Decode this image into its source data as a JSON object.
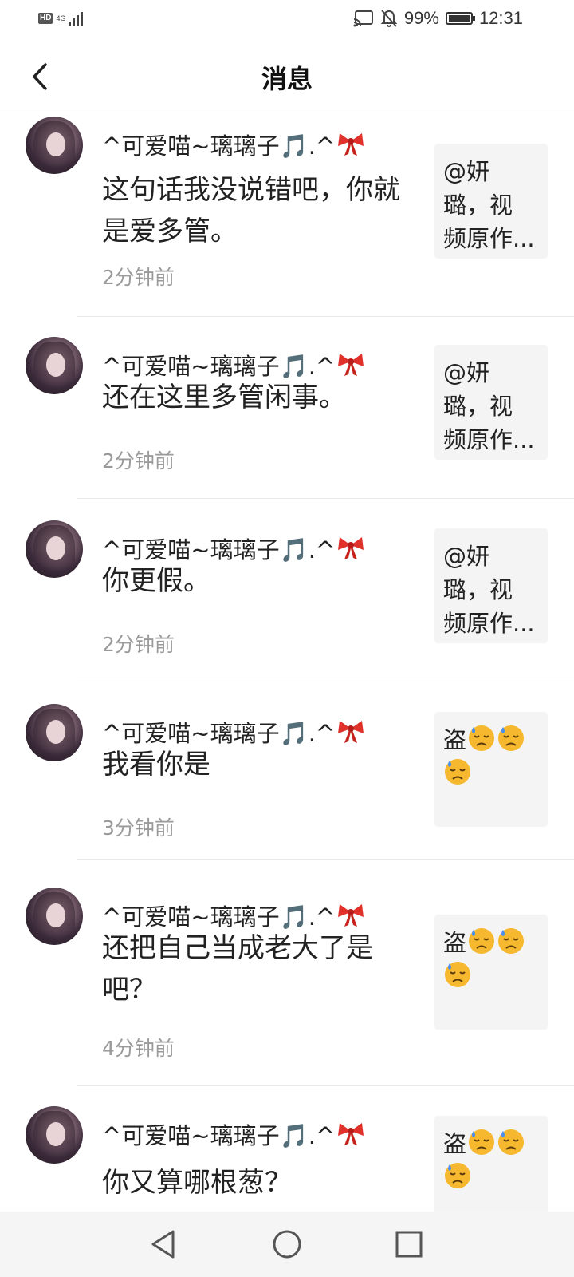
{
  "status_bar": {
    "hd": "HD",
    "network": "4G",
    "battery_percent": "99%",
    "time": "12:31"
  },
  "header": {
    "title": "消息"
  },
  "messages": [
    {
      "nickname": "^可爱喵~璃璃子🎵.^",
      "text": "这句话我没说错吧，你就是爱多管。",
      "time": "2分钟前",
      "preview_lines": [
        "@妍",
        "璐，视",
        "频原作..."
      ]
    },
    {
      "nickname": "^可爱喵~璃璃子🎵.^",
      "text": "还在这里多管闲事。",
      "time": "2分钟前",
      "preview_lines": [
        "@妍",
        "璐，视",
        "频原作..."
      ]
    },
    {
      "nickname": "^可爱喵~璃璃子🎵.^",
      "text": "你更假。",
      "time": "2分钟前",
      "preview_lines": [
        "@妍",
        "璐，视",
        "频原作..."
      ]
    },
    {
      "nickname": "^可爱喵~璃璃子🎵.^",
      "text": "我看你是",
      "time": "3分钟前",
      "preview_lines": [
        "盗"
      ]
    },
    {
      "nickname": "^可爱喵~璃璃子🎵.^",
      "text": "还把自己当成老大了是吧？",
      "time": "4分钟前",
      "preview_lines": [
        "盗"
      ]
    },
    {
      "nickname": "^可爱喵~璃璃子🎵.^",
      "text": "你又算哪根葱？",
      "time": "",
      "preview_lines": [
        "盗"
      ]
    }
  ],
  "icons": {
    "back": "chevron-left-icon",
    "nav_back": "triangle-back-icon",
    "nav_home": "circle-home-icon",
    "nav_recent": "square-recent-icon"
  }
}
